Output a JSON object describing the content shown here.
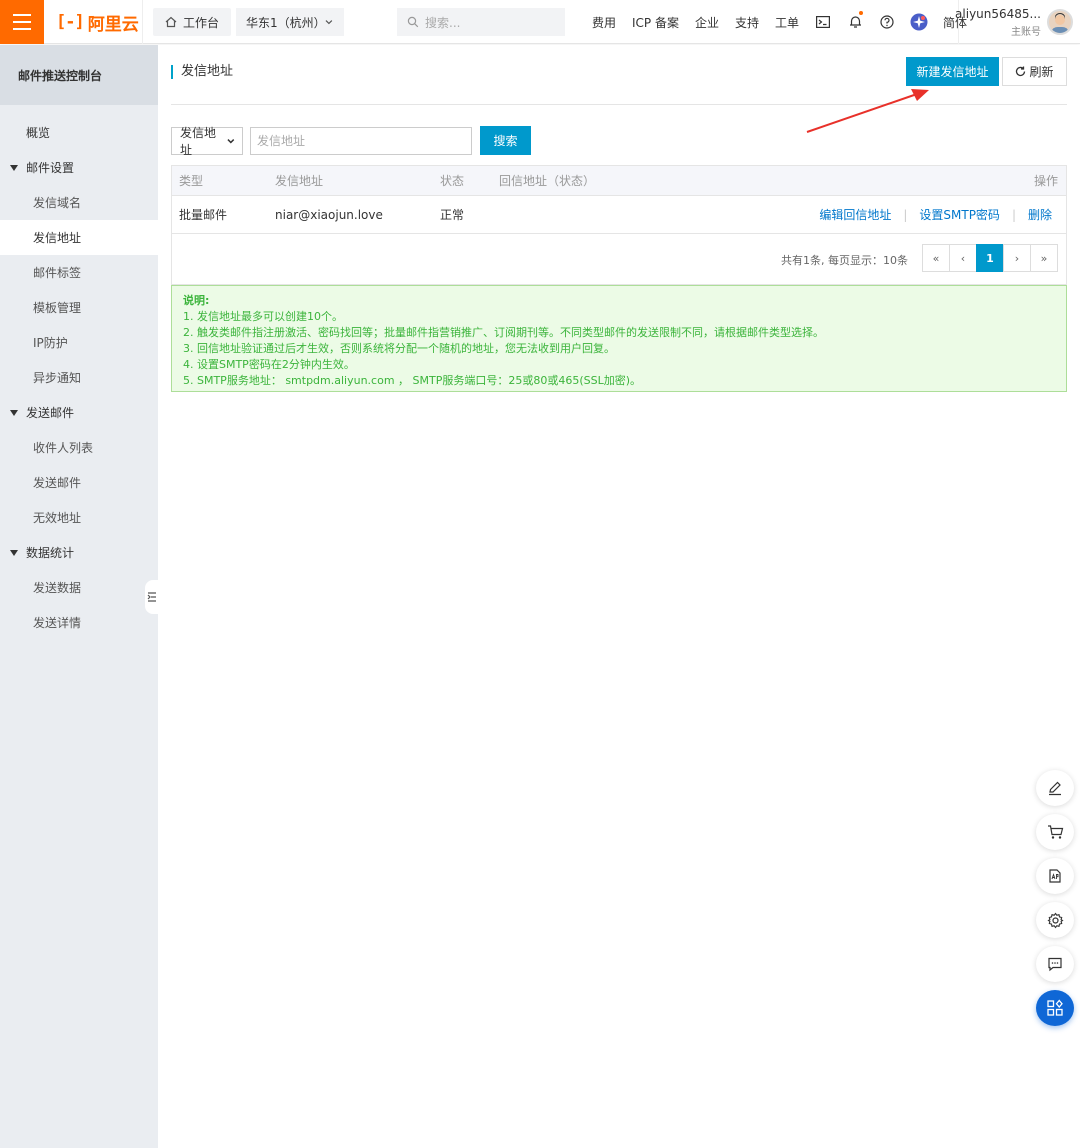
{
  "topbar": {
    "logo_mark": "[-]",
    "logo_text": "阿里云",
    "workbench": "工作台",
    "region": "华东1（杭州）",
    "search_placeholder": "搜索...",
    "nav": [
      "费用",
      "ICP 备案",
      "企业",
      "支持",
      "工单"
    ],
    "lang": "简体",
    "user_name": "aliyun56485...",
    "user_role": "主账号"
  },
  "sidebar": {
    "title": "邮件推送控制台",
    "overview": "概览",
    "groups": [
      {
        "label": "邮件设置",
        "items": [
          "发信域名",
          "发信地址",
          "邮件标签",
          "模板管理",
          "IP防护",
          "异步通知"
        ]
      },
      {
        "label": "发送邮件",
        "items": [
          "收件人列表",
          "发送邮件",
          "无效地址"
        ]
      },
      {
        "label": "数据统计",
        "items": [
          "发送数据",
          "发送详情"
        ]
      }
    ]
  },
  "page": {
    "title": "发信地址",
    "new_button": "新建发信地址",
    "refresh_button": "刷新"
  },
  "filter": {
    "select_value": "发信地址",
    "input_placeholder": "发信地址",
    "search_button": "搜索"
  },
  "table": {
    "headers": [
      "类型",
      "发信地址",
      "状态",
      "回信地址（状态）",
      "操作"
    ],
    "rows": [
      {
        "type": "批量邮件",
        "address": "niar@xiaojun.love",
        "status": "正常",
        "reply": "",
        "ops": [
          "编辑回信地址",
          "设置SMTP密码",
          "删除"
        ]
      }
    ],
    "pager_info": "共有1条, 每页显示：10条",
    "pages": [
      "«",
      "‹",
      "1",
      "›",
      "»"
    ]
  },
  "notice": {
    "title": "说明:",
    "lines": [
      "1. 发信地址最多可以创建10个。",
      "2. 触发类邮件指注册激活、密码找回等；批量邮件指营销推广、订阅期刊等。不同类型邮件的发送限制不同，请根据邮件类型选择。",
      "3. 回信地址验证通过后才生效，否则系统将分配一个随机的地址，您无法收到用户回复。",
      "4. 设置SMTP密码在2分钟内生效。",
      "5. SMTP服务地址： smtpdm.aliyun.com ， SMTP服务端口号：25或80或465(SSL加密)。"
    ]
  },
  "colors": {
    "brand": "#ff6a00",
    "primary": "#0099cc",
    "notice_text": "#3bb43b",
    "arrow": "#e8312a"
  },
  "icons": [
    "menu-icon",
    "home-icon",
    "chevron-down-icon",
    "search-icon",
    "terminal-icon",
    "bell-icon",
    "help-icon",
    "app-icon",
    "refresh-icon",
    "edit-icon",
    "cart-icon",
    "api-icon",
    "gear-icon",
    "feedback-icon",
    "grid-icon"
  ]
}
